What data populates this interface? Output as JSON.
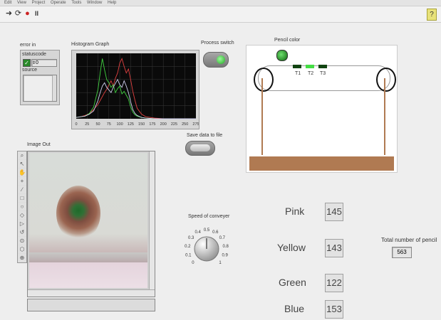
{
  "menu": [
    "Edit",
    "View",
    "Project",
    "Operate",
    "Tools",
    "Window",
    "Help"
  ],
  "toolbar": {
    "run": "➜",
    "run_continuous": "⟳",
    "abort": "●",
    "pause": "II",
    "help": "?"
  },
  "error_in": {
    "label": "error in",
    "status_label": "status",
    "code_label": "code",
    "code_value": "0",
    "check": "✓",
    "source_label": "source"
  },
  "histogram": {
    "label": "Histogram Graph",
    "ticks": [
      "0",
      "25",
      "50",
      "75",
      "100",
      "125",
      "150",
      "175",
      "200",
      "225",
      "250",
      "275"
    ]
  },
  "chart_data": {
    "type": "line",
    "title": "Histogram Graph",
    "xlabel": "",
    "ylabel": "",
    "xlim": [
      0,
      275
    ],
    "x": [
      0,
      10,
      20,
      30,
      40,
      50,
      55,
      60,
      65,
      70,
      75,
      80,
      85,
      90,
      95,
      100,
      105,
      110,
      115,
      120,
      125,
      130,
      135,
      140,
      150,
      160,
      180,
      200,
      250,
      275
    ],
    "series": [
      {
        "color": "#e04040",
        "values": [
          2,
          3,
          5,
          8,
          14,
          22,
          28,
          34,
          40,
          45,
          52,
          58,
          50,
          62,
          70,
          85,
          92,
          80,
          70,
          76,
          60,
          42,
          28,
          16,
          7,
          3,
          1,
          0,
          0,
          0
        ]
      },
      {
        "color": "#40d040",
        "values": [
          2,
          3,
          4,
          8,
          18,
          45,
          70,
          92,
          75,
          60,
          55,
          48,
          52,
          40,
          46,
          50,
          38,
          42,
          36,
          30,
          18,
          10,
          6,
          4,
          2,
          1,
          0,
          0,
          0,
          0
        ]
      },
      {
        "color": "#d0d0f0",
        "values": [
          2,
          3,
          4,
          7,
          12,
          28,
          40,
          50,
          55,
          48,
          44,
          40,
          48,
          54,
          60,
          52,
          48,
          58,
          50,
          40,
          26,
          14,
          8,
          5,
          2,
          1,
          0,
          0,
          0,
          0
        ]
      }
    ]
  },
  "process_switch": "Process switch",
  "save_data": "Save data to file",
  "image_out": "Image Out",
  "pencil_color": "Pencil color",
  "sensors": [
    "T1",
    "T2",
    "T3"
  ],
  "speed": {
    "label": "Speed of conveyer",
    "scale": [
      "0",
      "0.1",
      "0.2",
      "0.3",
      "0.4",
      "0.5",
      "0.6",
      "0.7",
      "0.8",
      "0.9",
      "1"
    ]
  },
  "counts": {
    "pink_label": "Pink",
    "pink": "145",
    "yellow_label": "Yellow",
    "yellow": "143",
    "green_label": "Green",
    "green": "122",
    "blue_label": "Blue",
    "blue": "153"
  },
  "total": {
    "label": "Total number of pencil",
    "value": "563"
  },
  "tools": [
    "⌕",
    "↖",
    "✋",
    "+",
    "∕",
    "□",
    "○",
    "◇",
    "▷",
    "↺",
    "⊙",
    "⬡",
    "⊕"
  ]
}
